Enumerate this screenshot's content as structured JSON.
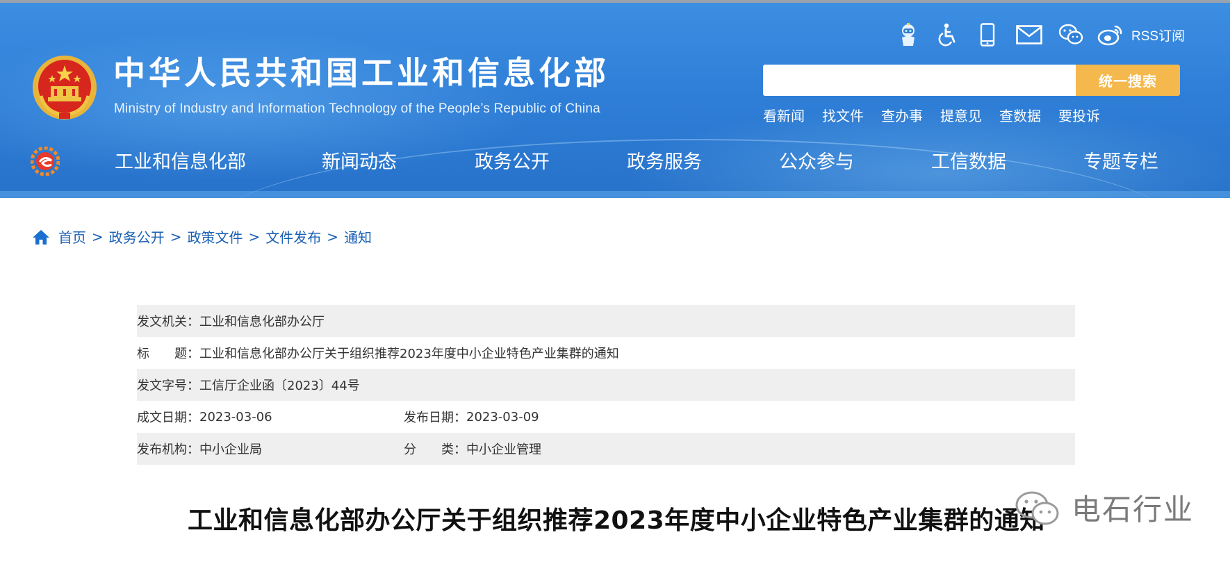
{
  "header": {
    "title": "中华人民共和国工业和信息化部",
    "subtitle": "Ministry of Industry and Information Technology of the People’s Republic of China",
    "util_icons": [
      "robot-assistant-icon",
      "accessibility-icon",
      "mobile-phone-icon",
      "mail-icon",
      "wechat-icon",
      "weibo-icon"
    ],
    "rss_label": "RSS订阅",
    "search": {
      "placeholder": "",
      "button_label": "统一搜索"
    },
    "quick_links": [
      "看新闻",
      "找文件",
      "查办事",
      "提意见",
      "查数据",
      "要投诉"
    ],
    "nav": [
      "工业和信息化部",
      "新闻动态",
      "政务公开",
      "政务服务",
      "公众参与",
      "工信数据",
      "专题专栏"
    ]
  },
  "breadcrumb": [
    "首页",
    "政务公开",
    "政策文件",
    "文件发布",
    "通知"
  ],
  "breadcrumb_separator": ">",
  "meta": {
    "issuer_label": "发文机关：",
    "issuer": "工业和信息化部办公厅",
    "title_label": "标　　题：",
    "title": "工业和信息化部办公厅关于组织推荐2023年度中小企业特色产业集群的通知",
    "doc_no_label": "发文字号：",
    "doc_no": "工信厅企业函〔2023〕44号",
    "written_date_label": "成文日期：",
    "written_date": "2023-03-06",
    "publish_date_label": "发布日期：",
    "publish_date": "2023-03-09",
    "org_label": "发布机构：",
    "org": "中小企业局",
    "category_label": "分　　类：",
    "category": "中小企业管理"
  },
  "article": {
    "title": "工业和信息化部办公厅关于组织推荐2023年度中小企业特色产业集群的通知"
  },
  "watermark": {
    "text": "电石行业",
    "icon": "wechat-icon"
  },
  "colors": {
    "header_blue": "#2f7fd8",
    "search_button": "#f5b84d",
    "link_blue": "#1a5fb4",
    "meta_row_gray": "#efefef"
  }
}
